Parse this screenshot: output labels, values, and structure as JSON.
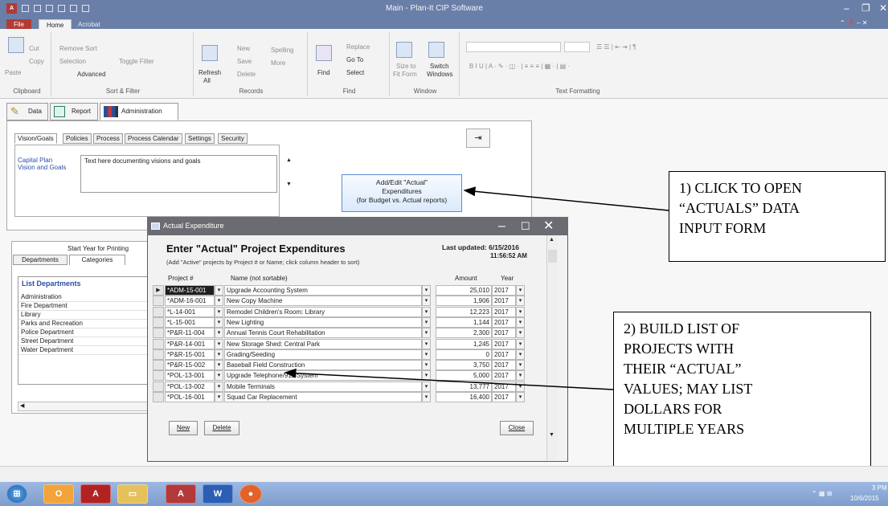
{
  "window": {
    "title": "Main - Plan-It CIP Software"
  },
  "ribbon": {
    "tabs": [
      "File",
      "Home",
      "Acrobat"
    ],
    "clipboard": {
      "paste": "Paste",
      "cut": "Cut",
      "copy": "Copy",
      "group": "Clipboard"
    },
    "sort_filter": {
      "remove_sort": "Remove Sort",
      "selection": "Selection",
      "toggle_filter": "Toggle Filter",
      "advanced": "Advanced",
      "group": "Sort & Filter"
    },
    "records": {
      "refresh": "Refresh",
      "refresh_all": "All",
      "new": "New",
      "save": "Save",
      "delete": "Delete",
      "spelling": "Spelling",
      "more": "More",
      "group": "Records"
    },
    "find": {
      "find": "Find",
      "replace": "Replace",
      "goto": "Go To",
      "select": "Select",
      "group": "Find"
    },
    "window": {
      "size_to": "Size to",
      "fit_form": "Fit Form",
      "switch": "Switch",
      "windows": "Windows",
      "group": "Window"
    },
    "text_formatting": {
      "group": "Text Formatting"
    }
  },
  "nav_tabs": [
    {
      "label": "Data",
      "icon": "pencil-icon"
    },
    {
      "label": "Report",
      "icon": "report-icon"
    },
    {
      "label": "Administration",
      "icon": "books-icon"
    }
  ],
  "admin": {
    "sub_tabs": [
      "Vision/Goals",
      "Policies",
      "Process",
      "Process Calendar",
      "Settings",
      "Security"
    ],
    "capital_plan_label_1": "Capital Plan",
    "capital_plan_label_2": "Vision and Goals",
    "vision_text": "Text here documenting visions and goals",
    "add_edit_button": {
      "line1": "Add/Edit \"Actual\"",
      "line2": "Expenditures",
      "line3": "(for Budget vs. Actual reports)"
    }
  },
  "left_panel": {
    "start_year_label": "Start Year for Printing",
    "tabs": [
      "Departments",
      "Categories"
    ],
    "list_title": "List Departments",
    "departments": [
      "Administration",
      "Fire Department",
      "Library",
      "Parks and Recreation",
      "Police Department",
      "Street Department",
      "Water Department"
    ]
  },
  "dialog": {
    "title": "Actual Expenditure",
    "heading": "Enter \"Actual\" Project Expenditures",
    "subheading": "(Add \"Active\" projects by Project # or Name; click column header to sort)",
    "last_updated_label": "Last updated:",
    "last_updated_date": "6/15/2016",
    "last_updated_time": "11:56:52 AM",
    "columns": {
      "project": "Project #",
      "name": "Name (not sortable)",
      "amount": "Amount",
      "year": "Year"
    },
    "rows": [
      {
        "project": "*ADM-15-001",
        "name": "Upgrade Accounting System",
        "amount": "25,010",
        "year": "2017"
      },
      {
        "project": "*ADM-16-001",
        "name": "New Copy Machine",
        "amount": "1,906",
        "year": "2017"
      },
      {
        "project": "*L-14-001",
        "name": "Remodel Children's Room: Library",
        "amount": "12,223",
        "year": "2017"
      },
      {
        "project": "*L-15-001",
        "name": "New Lighting",
        "amount": "1,144",
        "year": "2017"
      },
      {
        "project": "*P&R-11-004",
        "name": "Annual Tennis Court Rehabilitation",
        "amount": "2,300",
        "year": "2017"
      },
      {
        "project": "*P&R-14-001",
        "name": "New Storage Shed: Central Park",
        "amount": "1,245",
        "year": "2017"
      },
      {
        "project": "*P&R-15-001",
        "name": "Grading/Seeding",
        "amount": "0",
        "year": "2017"
      },
      {
        "project": "*P&R-15-002",
        "name": "Baseball Field Construction",
        "amount": "3,750",
        "year": "2017"
      },
      {
        "project": "*POL-13-001",
        "name": "Upgrade Telephone/911 System",
        "amount": "5,000",
        "year": "2017"
      },
      {
        "project": "*POL-13-002",
        "name": "Mobile Terminals",
        "amount": "13,777",
        "year": "2017"
      },
      {
        "project": "*POL-16-001",
        "name": "Squad Car Replacement",
        "amount": "16,400",
        "year": "2017"
      }
    ],
    "new_button": "New",
    "delete_button": "Delete",
    "close_button": "Close"
  },
  "callouts": {
    "one": [
      "1) CLICK TO OPEN",
      "“ACTUALS” DATA",
      "INPUT FORM"
    ],
    "two": [
      "2) BUILD LIST OF",
      "PROJECTS WITH",
      "THEIR “ACTUAL”",
      "VALUES;  MAY LIST",
      "DOLLARS FOR",
      "MULTIPLE YEARS"
    ]
  },
  "taskbar": {
    "apps": [
      "start-orb-icon",
      "outlook-icon",
      "acrobat-icon",
      "explorer-icon",
      "access-icon",
      "word-icon",
      "firefox-icon"
    ],
    "time_fragment": "3 PM",
    "date": "10/6/2015"
  }
}
